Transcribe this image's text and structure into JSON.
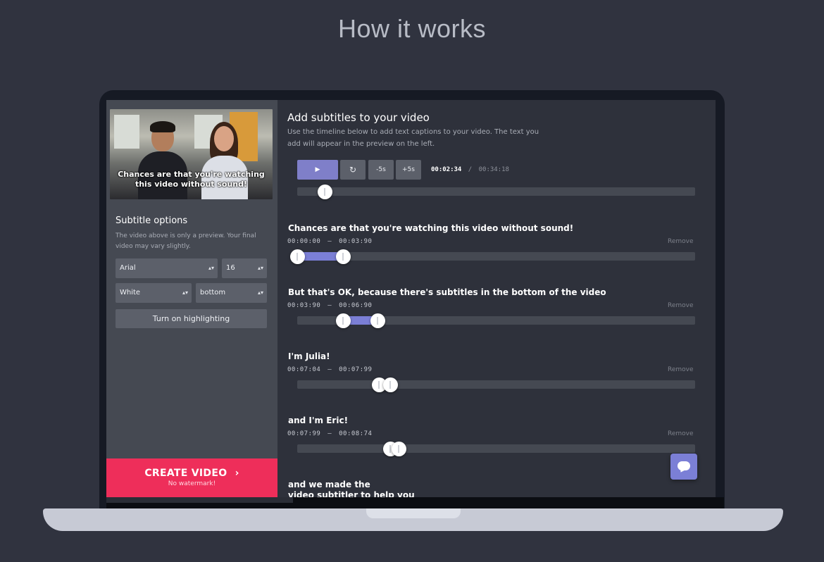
{
  "page": {
    "heading": "How it works"
  },
  "left": {
    "video_caption_line1": "Chances are that you're watching",
    "video_caption_line2": "this video without sound!",
    "options_title": "Subtitle options",
    "options_desc": "The video above is only a preview. Your final video may vary slightly.",
    "font_select": "Arial",
    "size_select": "16",
    "color_select": "White",
    "position_select": "bottom",
    "highlight_button": "Turn on highlighting",
    "create_button": "CREATE VIDEO",
    "create_arrow": "›",
    "create_sub": "No watermark!"
  },
  "right": {
    "title": "Add subtitles to your video",
    "desc": "Use the timeline below to add text captions to your video. The text you add will appear in the preview on the left.",
    "controls": {
      "play_icon": "▶",
      "replay_icon": "↻",
      "back_label": "-5s",
      "forward_label": "+5s",
      "current_time": "00:02:34",
      "separator": "/",
      "total_time": "00:34:18"
    },
    "playhead_position": 0.069,
    "subtitles": [
      {
        "text": "Chances are that you're watching this video without sound!",
        "start": "00:00:00",
        "dash": "–",
        "end": "00:03:90",
        "remove": "Remove"
      },
      {
        "text": "But that's OK, because there's subtitles in the bottom of the video",
        "start": "00:03:90",
        "dash": "–",
        "end": "00:06:90",
        "remove": "Remove"
      },
      {
        "text": "I'm Julia!",
        "start": "00:07:04",
        "dash": "–",
        "end": "00:07:99",
        "remove": "Remove"
      },
      {
        "text": "and I'm Eric!",
        "start": "00:07:99",
        "dash": "–",
        "end": "00:08:74",
        "remove": "Remove"
      },
      {
        "text_line1": "and we made the",
        "text_line2": "video subtitler to help you"
      }
    ]
  },
  "colors": {
    "background": "#30333f",
    "accent_purple": "#7b7fd6",
    "create_red": "#ee2e5a"
  }
}
